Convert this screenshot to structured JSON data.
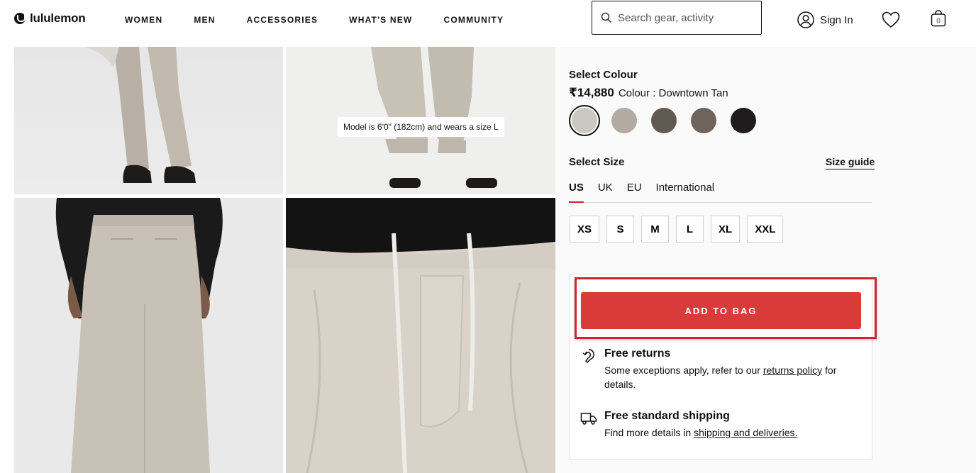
{
  "header": {
    "brand": "lululemon",
    "nav": [
      "WOMEN",
      "MEN",
      "ACCESSORIES",
      "WHAT'S NEW",
      "COMMUNITY"
    ],
    "search_placeholder": "Search gear, activity",
    "sign_in": "Sign In",
    "bag_count": "0",
    "icons": [
      "search-icon",
      "user-icon",
      "heart-icon",
      "bag-icon"
    ]
  },
  "gallery": {
    "model_note": "Model is 6'0\" (182cm) and wears a size L"
  },
  "product": {
    "select_colour_label": "Select Colour",
    "price": "₹14,880",
    "colour_label": "Colour : Downtown Tan",
    "swatches": [
      {
        "color": "#cbc7c1",
        "selected": true
      },
      {
        "color": "#b3aba1",
        "selected": false
      },
      {
        "color": "#5f5952",
        "selected": false
      },
      {
        "color": "#6e645c",
        "selected": false
      },
      {
        "color": "#1e1c1c",
        "selected": false
      }
    ],
    "select_size_label": "Select Size",
    "size_guide": "Size guide",
    "size_tabs": [
      "US",
      "UK",
      "EU",
      "International"
    ],
    "active_size_tab": "US",
    "sizes": [
      "XS",
      "S",
      "M",
      "L",
      "XL",
      "XXL"
    ],
    "add_to_bag": "ADD TO BAG",
    "accent_color": "#d93a3a"
  },
  "info": {
    "returns_title": "Free returns",
    "returns_body_pre": "Some exceptions apply, refer to our",
    "returns_link": "returns policy",
    "returns_body_post": "for details.",
    "shipping_title": "Free standard shipping",
    "shipping_body_pre": "Find more details in",
    "shipping_link": "shipping and deliveries."
  }
}
